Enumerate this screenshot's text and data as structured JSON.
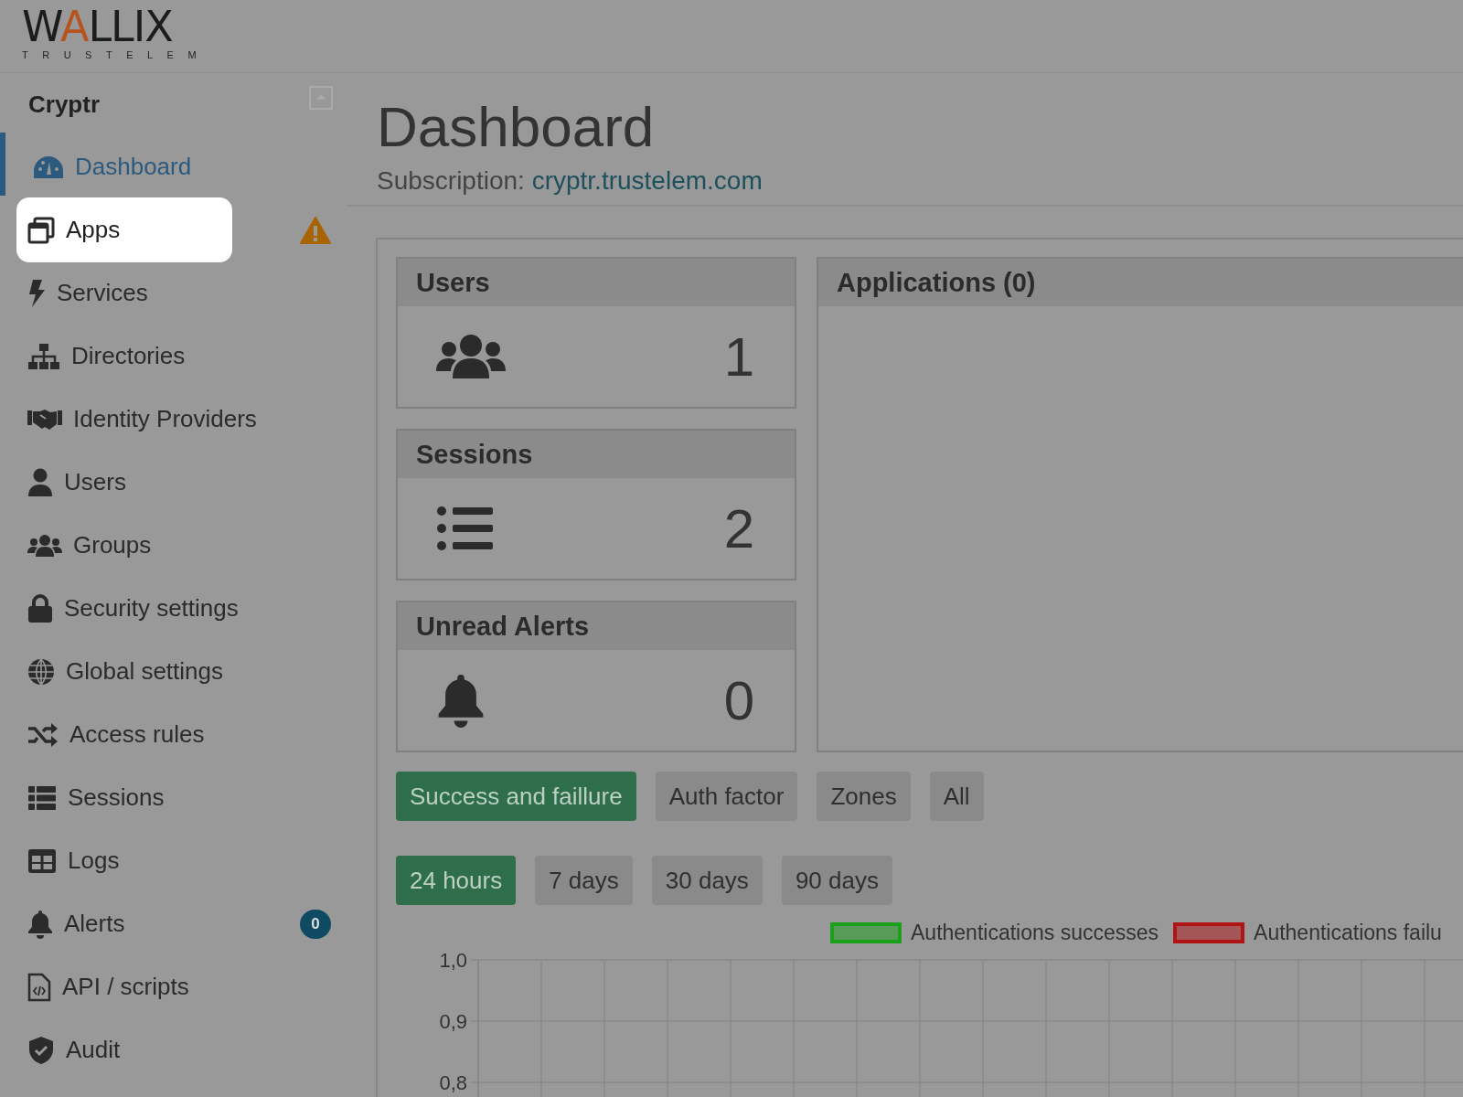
{
  "logo": {
    "wordmark": "WALLIX",
    "tagline": "TRUSTELEM"
  },
  "sidebar": {
    "title": "Cryptr",
    "items": [
      {
        "label": "Dashboard",
        "selected": true,
        "highlighted": false,
        "warning": false
      },
      {
        "label": "Apps",
        "selected": false,
        "highlighted": true,
        "warning": true
      },
      {
        "label": "Services",
        "selected": false,
        "highlighted": false,
        "warning": false
      },
      {
        "label": "Directories",
        "selected": false,
        "highlighted": false,
        "warning": false
      },
      {
        "label": "Identity Providers",
        "selected": false,
        "highlighted": false,
        "warning": false
      },
      {
        "label": "Users",
        "selected": false,
        "highlighted": false,
        "warning": false
      },
      {
        "label": "Groups",
        "selected": false,
        "highlighted": false,
        "warning": false
      },
      {
        "label": "Security settings",
        "selected": false,
        "highlighted": false,
        "warning": false
      },
      {
        "label": "Global settings",
        "selected": false,
        "highlighted": false,
        "warning": false
      },
      {
        "label": "Access rules",
        "selected": false,
        "highlighted": false,
        "warning": false
      },
      {
        "label": "Sessions",
        "selected": false,
        "highlighted": false,
        "warning": false
      },
      {
        "label": "Logs",
        "selected": false,
        "highlighted": false,
        "warning": false
      },
      {
        "label": "Alerts",
        "selected": false,
        "highlighted": false,
        "warning": false,
        "badge": "0"
      },
      {
        "label": "API / scripts",
        "selected": false,
        "highlighted": false,
        "warning": false
      },
      {
        "label": "Audit",
        "selected": false,
        "highlighted": false,
        "warning": false
      }
    ]
  },
  "main": {
    "title": "Dashboard",
    "subscription_label": "Subscription:",
    "subscription_link": "cryptr.trustelem.com",
    "stats": [
      {
        "title": "Users",
        "value": "1"
      },
      {
        "title": "Sessions",
        "value": "2"
      },
      {
        "title": "Unread Alerts",
        "value": "0"
      }
    ],
    "applications": {
      "title": "Applications (0)"
    },
    "filters": [
      {
        "label": "Success and faillure",
        "selected": true
      },
      {
        "label": "Auth factor",
        "selected": false
      },
      {
        "label": "Zones",
        "selected": false
      },
      {
        "label": "All",
        "selected": false
      }
    ],
    "periods": [
      {
        "label": "24 hours",
        "selected": true
      },
      {
        "label": "7 days",
        "selected": false
      },
      {
        "label": "30 days",
        "selected": false
      },
      {
        "label": "90 days",
        "selected": false
      }
    ],
    "chart_data": {
      "type": "line",
      "series": [
        {
          "name": "Authentications successes",
          "color": "#1aa01a"
        },
        {
          "name": "Authentications failu",
          "color": "#b01414"
        }
      ],
      "ylim": [
        0.8,
        1.0
      ],
      "yticks": [
        {
          "value": 1.0,
          "label": "1,0"
        },
        {
          "value": 0.9,
          "label": "0,9"
        },
        {
          "value": 0.8,
          "label": "0,8"
        }
      ]
    }
  }
}
